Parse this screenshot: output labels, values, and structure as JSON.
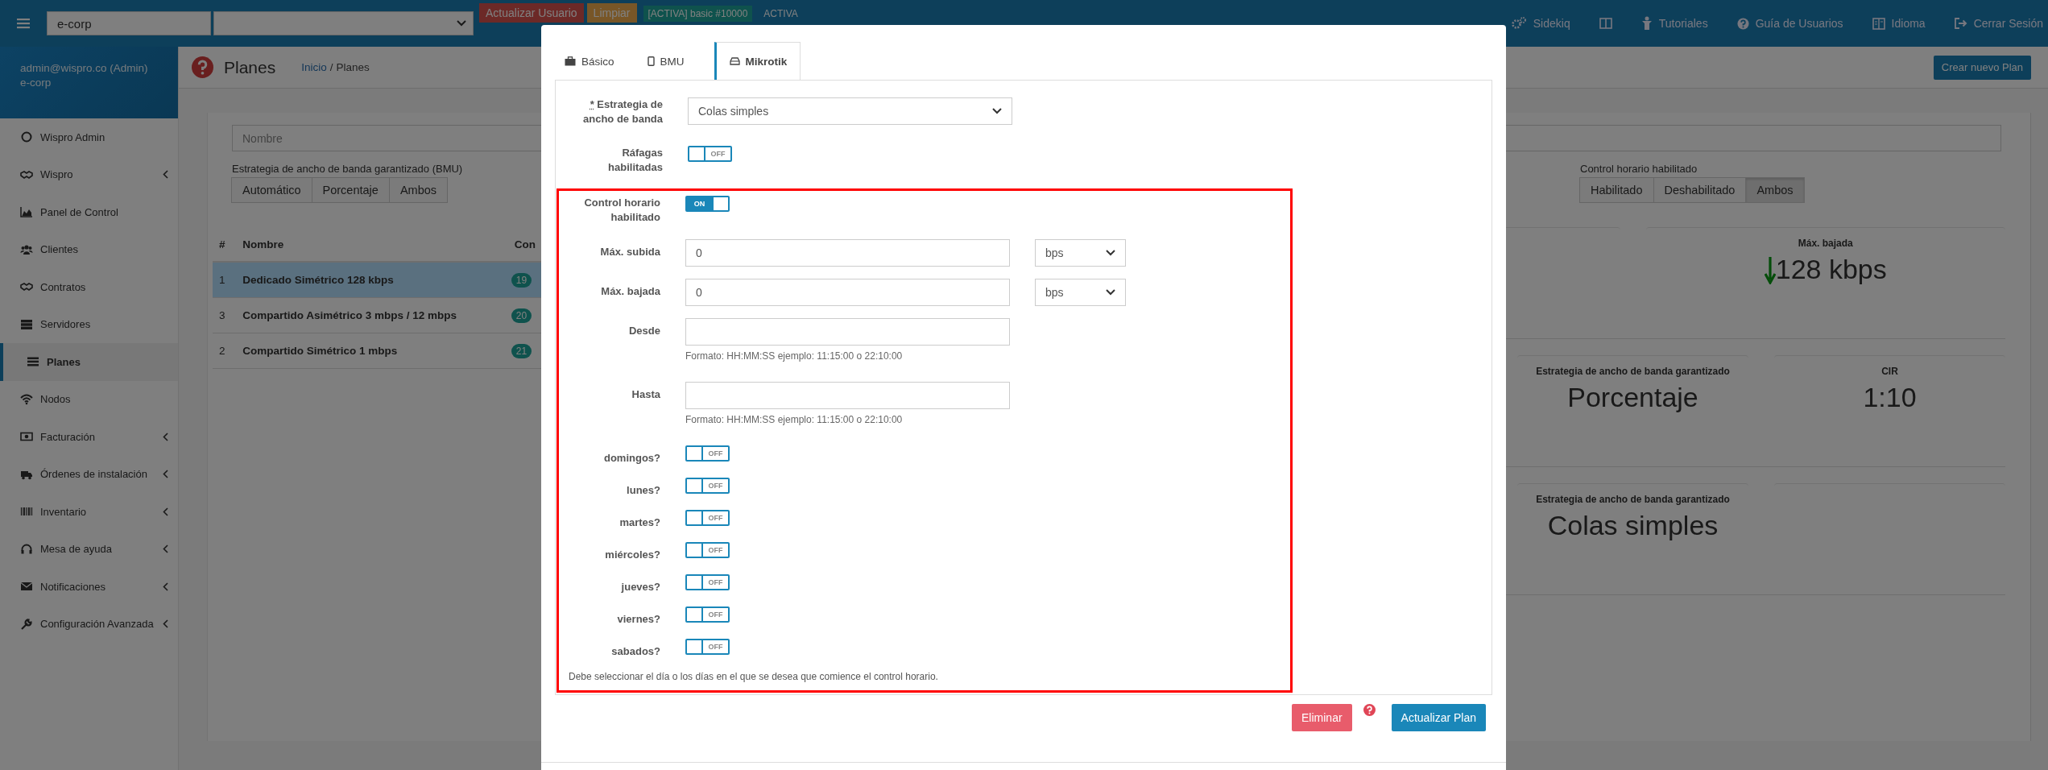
{
  "top_bar": {
    "company_field": {
      "value": "e-corp"
    },
    "buttons": [
      {
        "label": "Actualizar Usuario",
        "kind": "danger"
      },
      {
        "label": "Limpiar",
        "kind": "warning"
      }
    ],
    "plan_badge": "[ACTIVA] basic #10000",
    "status": "ACTIVA",
    "links": [
      "Sidekiq",
      "Tutoriales",
      "Guía de Usuarios",
      "Idioma",
      "Cerrar Sesión"
    ]
  },
  "sidebar": {
    "user": "admin@wispro.co (Admin)",
    "company": "e-corp",
    "items": [
      {
        "label": "Wispro Admin",
        "has_submenu": false,
        "selected": false
      },
      {
        "label": "Wispro",
        "has_submenu": true,
        "selected": false
      },
      {
        "label": "Panel de Control",
        "has_submenu": false,
        "selected": false
      },
      {
        "label": "Clientes",
        "has_submenu": false,
        "selected": false
      },
      {
        "label": "Contratos",
        "has_submenu": false,
        "selected": false
      },
      {
        "label": "Servidores",
        "has_submenu": false,
        "selected": false
      },
      {
        "label": "Planes",
        "has_submenu": false,
        "selected": true
      },
      {
        "label": "Nodos",
        "has_submenu": false,
        "selected": false
      },
      {
        "label": "Facturación",
        "has_submenu": true,
        "selected": false
      },
      {
        "label": "Órdenes de instalación",
        "has_submenu": true,
        "selected": false
      },
      {
        "label": "Inventario",
        "has_submenu": true,
        "selected": false
      },
      {
        "label": "Mesa de ayuda",
        "has_submenu": true,
        "selected": false
      },
      {
        "label": "Notificaciones",
        "has_submenu": true,
        "selected": false
      },
      {
        "label": "Configuración Avanzada",
        "has_submenu": true,
        "selected": false
      }
    ]
  },
  "page": {
    "title": "Planes",
    "breadcrumb": [
      {
        "label": "Inicio",
        "link": true
      },
      {
        "label": "Planes",
        "link": false
      }
    ],
    "breadcrumb_separator": "/",
    "create_button": "Crear nuevo Plan",
    "name_filter": {
      "placeholder": "Nombre"
    },
    "filter_groups": [
      {
        "label": "Estrategia de ancho de banda garantizado (BMU)",
        "options": [
          {
            "label": "Automático",
            "selected": false
          },
          {
            "label": "Porcentaje",
            "selected": false
          },
          {
            "label": "Ambos",
            "selected": false
          }
        ]
      },
      {
        "label": "Control horario habilitado",
        "options": [
          {
            "label": "Habilitado",
            "selected": false
          },
          {
            "label": "Deshabilitado",
            "selected": false
          },
          {
            "label": "Ambos",
            "selected": true
          }
        ]
      }
    ],
    "table": {
      "columns": [
        "#",
        "Nombre",
        "Con"
      ],
      "rows": [
        {
          "number": "1",
          "name": "Dedicado Simétrico 128 kbps",
          "count": "19",
          "selected": true
        },
        {
          "number": "3",
          "name": "Compartido Asimétrico 3 mbps / 12 mbps",
          "count": "20",
          "selected": false
        },
        {
          "number": "2",
          "name": "Compartido Simétrico 1 mbps",
          "count": "21",
          "selected": false
        }
      ]
    },
    "stats": [
      {
        "label": "Máx. bajada",
        "value": "128 kbps",
        "kind": "download"
      },
      {
        "label": "Estrategia de ancho de banda garantizado",
        "value": "Porcentaje",
        "kind": "plain"
      },
      {
        "label": "CIR",
        "value": "1:10",
        "kind": "plain"
      },
      {
        "label": "Estrategia de ancho de banda garantizado",
        "value": "Colas simples",
        "kind": "plain"
      }
    ]
  },
  "modal": {
    "tabs": [
      {
        "label": "Básico",
        "selected": false
      },
      {
        "label": "BMU",
        "selected": false
      },
      {
        "label": "Mikrotik",
        "selected": true
      }
    ],
    "fields": [
      {
        "kind": "select",
        "label": "Estrategia de ancho de banda",
        "required_mark": "*",
        "value": "Colas simples"
      },
      {
        "kind": "toggle",
        "label": "Ráfagas habilitadas",
        "on": false,
        "switch_text": "OFF"
      }
    ],
    "schedule": {
      "fields": [
        {
          "kind": "toggle",
          "label": "Control horario habilitado",
          "on": true,
          "switch_text": "ON"
        },
        {
          "kind": "unit_input",
          "label": "Máx. subida",
          "value": "0",
          "unit": "bps"
        },
        {
          "kind": "unit_input",
          "label": "Máx. bajada",
          "value": "0",
          "unit": "bps"
        },
        {
          "kind": "input",
          "label": "Desde",
          "hint": "Formato: HH:MM:SS ejemplo: 11:15:00 o 22:10:00"
        },
        {
          "kind": "input",
          "label": "Hasta",
          "hint": "Formato: HH:MM:SS ejemplo: 11:15:00 o 22:10:00"
        },
        {
          "kind": "toggle",
          "label": "domingos?",
          "on": false,
          "switch_text": "OFF"
        },
        {
          "kind": "toggle",
          "label": "lunes?",
          "on": false,
          "switch_text": "OFF"
        },
        {
          "kind": "toggle",
          "label": "martes?",
          "on": false,
          "switch_text": "OFF"
        },
        {
          "kind": "toggle",
          "label": "miércoles?",
          "on": false,
          "switch_text": "OFF"
        },
        {
          "kind": "toggle",
          "label": "jueves?",
          "on": false,
          "switch_text": "OFF"
        },
        {
          "kind": "toggle",
          "label": "viernes?",
          "on": false,
          "switch_text": "OFF"
        },
        {
          "kind": "toggle",
          "label": "sabados?",
          "on": false,
          "switch_text": "OFF"
        }
      ],
      "note": "Debe seleccionar el día o los días en el que se desea que comience el control horario."
    },
    "actions": [
      {
        "label": "Eliminar",
        "kind": "danger"
      },
      {
        "label": "Actualizar Plan",
        "kind": "primary"
      }
    ]
  }
}
